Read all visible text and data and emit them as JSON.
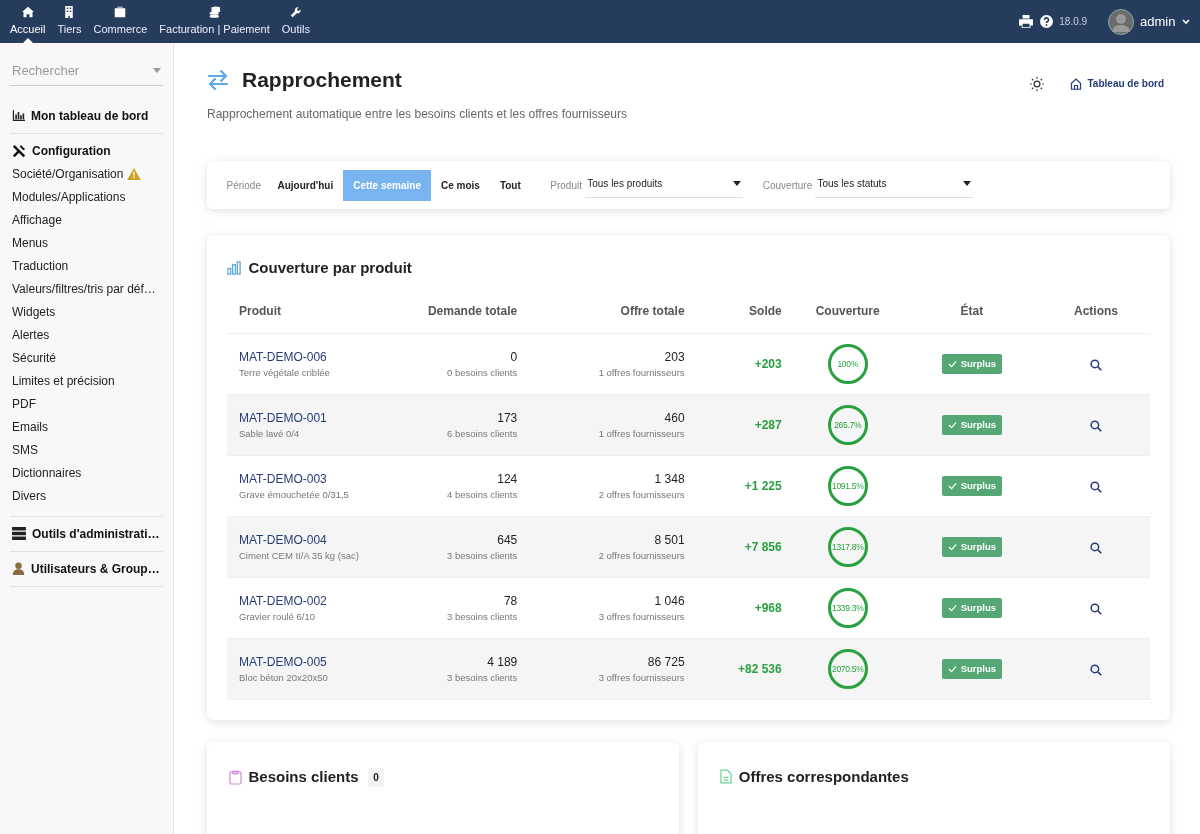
{
  "topbar": {
    "menu": [
      {
        "label": "Accueil",
        "selected": true
      },
      {
        "label": "Tiers",
        "selected": false
      },
      {
        "label": "Commerce",
        "selected": false
      },
      {
        "label": "Facturation | Paiement",
        "selected": false
      },
      {
        "label": "Outils",
        "selected": false
      }
    ],
    "version": "18.0.9",
    "user": "admin"
  },
  "sidebar": {
    "search": {
      "placeholder": "Rechercher"
    },
    "sections": [
      {
        "title": "Mon tableau de bord"
      },
      {
        "title": "Configuration",
        "items": [
          {
            "label": "Société/Organisation",
            "warning": true
          },
          {
            "label": "Modules/Applications",
            "warning": false
          },
          {
            "label": "Affichage",
            "warning": false
          },
          {
            "label": "Menus",
            "warning": false
          },
          {
            "label": "Traduction",
            "warning": false
          },
          {
            "label": "Valeurs/filtres/tris par déf…",
            "warning": false
          },
          {
            "label": "Widgets",
            "warning": false
          },
          {
            "label": "Alertes",
            "warning": false
          },
          {
            "label": "Sécurité",
            "warning": false
          },
          {
            "label": "Limites et précision",
            "warning": false
          },
          {
            "label": "PDF",
            "warning": false
          },
          {
            "label": "Emails",
            "warning": false
          },
          {
            "label": "SMS",
            "warning": false
          },
          {
            "label": "Dictionnaires",
            "warning": false
          },
          {
            "label": "Divers",
            "warning": false
          }
        ]
      },
      {
        "title": "Outils d'administrati…"
      },
      {
        "title": "Utilisateurs & Group…"
      }
    ]
  },
  "page": {
    "title": "Rapprochement",
    "subtitle": "Rapprochement automatique entre les besoins clients et les offres fournisseurs",
    "dashboard_link": "Tableau de bord"
  },
  "filters": {
    "period_label": "Période",
    "periods": [
      {
        "label": "Aujourd'hui",
        "selected": false
      },
      {
        "label": "Cette semaine",
        "selected": true
      },
      {
        "label": "Ce mois",
        "selected": false
      },
      {
        "label": "Tout",
        "selected": false
      }
    ],
    "selects": [
      {
        "label": "Produit",
        "value": "Tous les produits"
      },
      {
        "label": "Couverture",
        "value": "Tous les statuts"
      }
    ]
  },
  "coverage": {
    "title": "Couverture par produit",
    "columns": [
      "Produit",
      "Demande totale",
      "Offre totale",
      "Solde",
      "Couverture",
      "État",
      "Actions"
    ],
    "rows": [
      {
        "code": "MAT-DEMO-006",
        "name": "Terre végétale criblée",
        "demand": "0",
        "demand_note": "0 besoins clients",
        "offer": "203",
        "offer_note": "1 offres fournisseurs",
        "balance": "+203",
        "coverage": "100%",
        "status": "Surplus"
      },
      {
        "code": "MAT-DEMO-001",
        "name": "Sable lavé 0/4",
        "demand": "173",
        "demand_note": "6 besoins clients",
        "offer": "460",
        "offer_note": "1 offres fournisseurs",
        "balance": "+287",
        "coverage": "265.7%",
        "status": "Surplus"
      },
      {
        "code": "MAT-DEMO-003",
        "name": "Grave émouchetée 0/31,5",
        "demand": "124",
        "demand_note": "4 besoins clients",
        "offer": "1 348",
        "offer_note": "2 offres fournisseurs",
        "balance": "+1 225",
        "coverage": "1091.5%",
        "status": "Surplus"
      },
      {
        "code": "MAT-DEMO-004",
        "name": "Ciment CEM II/A 35 kg (sac)",
        "demand": "645",
        "demand_note": "3 besoins clients",
        "offer": "8 501",
        "offer_note": "2 offres fournisseurs",
        "balance": "+7 856",
        "coverage": "1317.8%",
        "status": "Surplus"
      },
      {
        "code": "MAT-DEMO-002",
        "name": "Gravier roulé 6/10",
        "demand": "78",
        "demand_note": "3 besoins clients",
        "offer": "1 046",
        "offer_note": "3 offres fournisseurs",
        "balance": "+968",
        "coverage": "1339.3%",
        "status": "Surplus"
      },
      {
        "code": "MAT-DEMO-005",
        "name": "Bloc béton 20x20x50",
        "demand": "4 189",
        "demand_note": "3 besoins clients",
        "offer": "86 725",
        "offer_note": "3 offres fournisseurs",
        "balance": "+82 536",
        "coverage": "2070.5%",
        "status": "Surplus"
      }
    ]
  },
  "panels": [
    {
      "title": "Besoins clients",
      "count": "0"
    },
    {
      "title": "Offres correspondantes"
    }
  ]
}
